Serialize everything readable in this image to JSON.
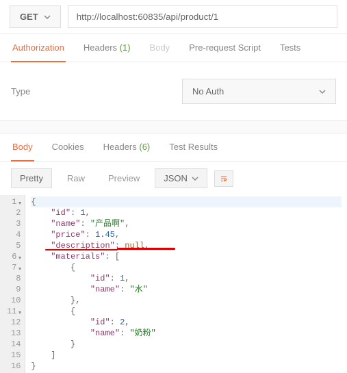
{
  "request": {
    "method": "GET",
    "url": "http://localhost:60835/api/product/1"
  },
  "tabs": {
    "authorization": "Authorization",
    "headers": "Headers",
    "headers_count": "(1)",
    "body": "Body",
    "prerequest": "Pre-request Script",
    "tests": "Tests"
  },
  "auth": {
    "type_label": "Type",
    "selected": "No Auth"
  },
  "resp_tabs": {
    "body": "Body",
    "cookies": "Cookies",
    "headers": "Headers",
    "headers_count": "(6)",
    "test_results": "Test Results"
  },
  "toolbar": {
    "pretty": "Pretty",
    "raw": "Raw",
    "preview": "Preview",
    "format": "JSON"
  },
  "code": {
    "lines": [
      "1",
      "2",
      "3",
      "4",
      "5",
      "6",
      "7",
      "8",
      "9",
      "10",
      "11",
      "12",
      "13",
      "14",
      "15",
      "16"
    ],
    "l1": "{",
    "l2_k": "\"id\"",
    "l2_v": "1",
    "l3_k": "\"name\"",
    "l3_v": "\"产品啊\"",
    "l4_k": "\"price\"",
    "l4_v": "1.45",
    "l5_k": "\"description\"",
    "l5_v": "null",
    "l6_k": "\"materials\"",
    "l8_k": "\"id\"",
    "l8_v": "1",
    "l9_k": "\"name\"",
    "l9_v": "\"水\"",
    "l12_k": "\"id\"",
    "l12_v": "2",
    "l13_k": "\"name\"",
    "l13_v": "\"奶粉\""
  }
}
